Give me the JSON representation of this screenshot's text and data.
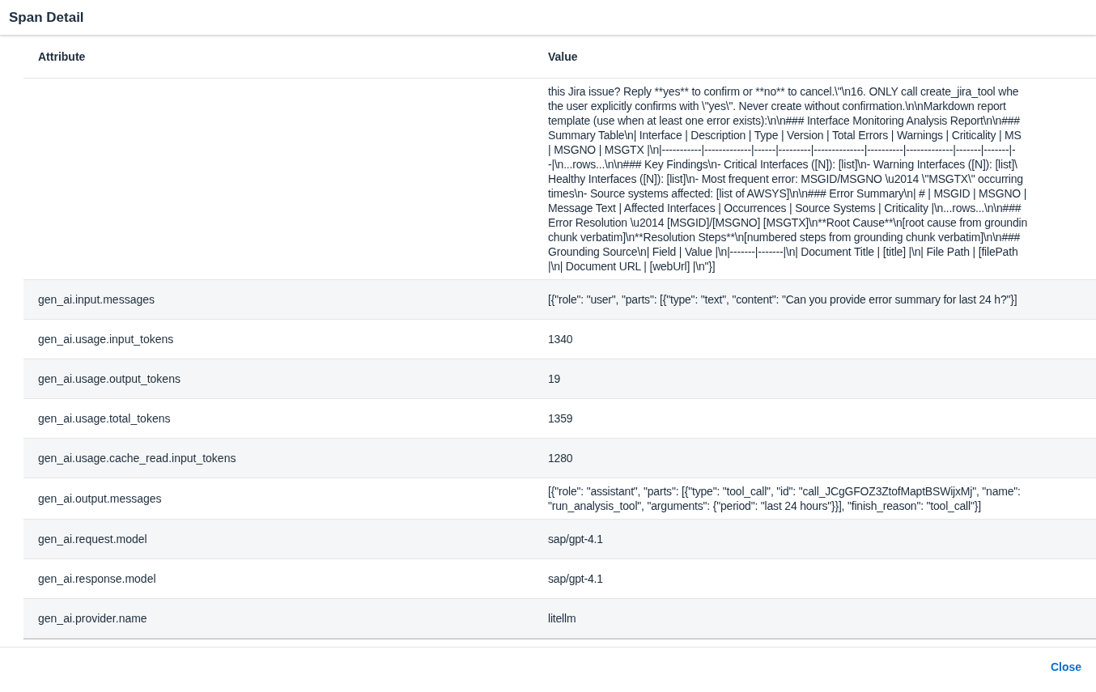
{
  "dialog": {
    "title": "Span Detail"
  },
  "table": {
    "columns": [
      "Attribute",
      "Value"
    ],
    "rows": [
      {
        "attribute": "",
        "value_lines": [
          "this Jira issue? Reply **yes** to confirm or **no** to cancel.\\\"\\n16. ONLY call create_jira_tool whe",
          "the user explicitly confirms with \\\"yes\\\". Never create without confirmation.\\n\\nMarkdown report",
          "template (use when at least one error exists):\\n\\n### Interface Monitoring Analysis Report\\n\\n###",
          "Summary Table\\n| Interface | Description | Type | Version | Total Errors | Warnings | Criticality | MS",
          "| MSGNO | MSGTX |\\n|-----------|-------------|------|---------|--------------|----------|-------------|-------|-------|-",
          "-|\\n...rows...\\n\\n### Key Findings\\n- Critical Interfaces ([N]): [list]\\n- Warning Interfaces ([N]): [list]\\",
          "Healthy Interfaces ([N]): [list]\\n- Most frequent error: MSGID/MSGNO \\u2014 \\\"MSGTX\\\" occurring",
          "times\\n- Source systems affected: [list of AWSYS]\\n\\n### Error Summary\\n| # | MSGID | MSGNO |",
          "Message Text | Affected Interfaces | Occurrences | Source Systems | Criticality |\\n...rows...\\n\\n###",
          "Error Resolution \\u2014 [MSGID]/[MSGNO] [MSGTX]\\n**Root Cause**\\n[root cause from groundin",
          "chunk verbatim]\\n**Resolution Steps**\\n[numbered steps from grounding chunk verbatim]\\n\\n###",
          "Grounding Source\\n| Field | Value |\\n|-------|-------|\\n| Document Title | [title] |\\n| File Path | [filePath",
          "|\\n| Document URL | [webUrl] |\\n\"}]"
        ]
      },
      {
        "attribute": "gen_ai.input.messages",
        "value": "[{\"role\": \"user\", \"parts\": [{\"type\": \"text\", \"content\": \"Can you provide error summary for last 24 h?\"}]"
      },
      {
        "attribute": "gen_ai.usage.input_tokens",
        "value": "1340"
      },
      {
        "attribute": "gen_ai.usage.output_tokens",
        "value": "19"
      },
      {
        "attribute": "gen_ai.usage.total_tokens",
        "value": "1359"
      },
      {
        "attribute": "gen_ai.usage.cache_read.input_tokens",
        "value": "1280"
      },
      {
        "attribute": "gen_ai.output.messages",
        "value": "[{\"role\": \"assistant\", \"parts\": [{\"type\": \"tool_call\", \"id\": \"call_JCgGFOZ3ZtofMaptBSWijxMj\", \"name\": \"run_analysis_tool\", \"arguments\": {\"period\": \"last 24 hours\"}}], \"finish_reason\": \"tool_call\"}]"
      },
      {
        "attribute": "gen_ai.request.model",
        "value": "sap/gpt-4.1"
      },
      {
        "attribute": "gen_ai.response.model",
        "value": "sap/gpt-4.1"
      },
      {
        "attribute": "gen_ai.provider.name",
        "value": "litellm"
      }
    ]
  },
  "buttons": [
    "Close"
  ]
}
